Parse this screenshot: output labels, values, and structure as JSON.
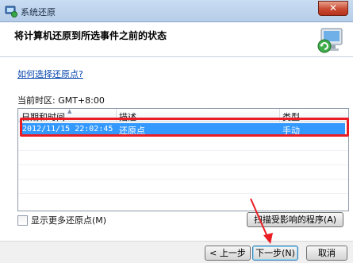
{
  "window": {
    "title": "系统还原",
    "close_glyph": "✕"
  },
  "header": {
    "title": "将计算机还原到所选事件之前的状态"
  },
  "help_link": "如何选择还原点?",
  "timezone": "当前时区: GMT+8:00",
  "list": {
    "columns": [
      "日期和时间",
      "描述",
      "类型"
    ],
    "rows": [
      {
        "date": "2012/11/15 22:02:45",
        "description": "还原点",
        "type": "手动",
        "selected": true
      }
    ]
  },
  "show_more_label": "显示更多还原点(M)",
  "scan_button": "扫描受影响的程序(A)",
  "footer": {
    "back_label": "< 上一步(B)",
    "next_label": "下一步(N) >",
    "cancel_label": "取消"
  },
  "colors": {
    "selection": "#3399ff",
    "annotation": "#ea1c24",
    "link": "#0645ad"
  },
  "icons": [
    "system-restore-icon",
    "restore-header-icon",
    "close-icon"
  ]
}
